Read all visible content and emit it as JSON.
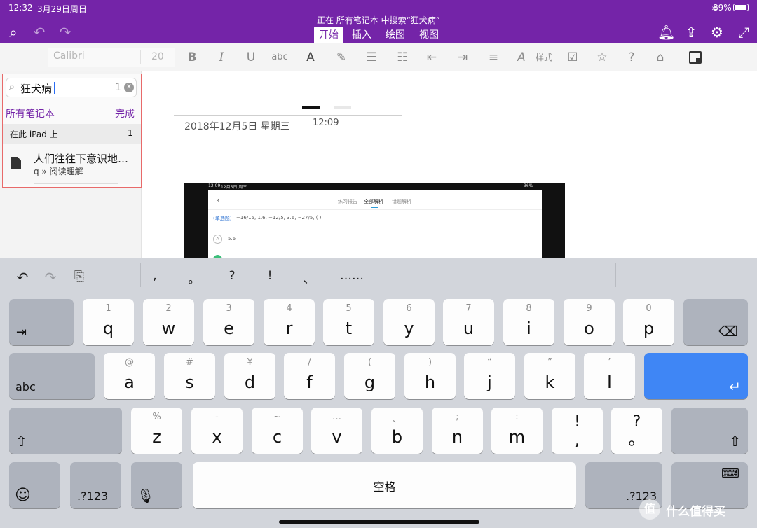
{
  "status_bar": {
    "time": "12:32",
    "date": "3月29日周日",
    "battery": "89%"
  },
  "title_bar": {
    "search_status": "正在 所有笔记本 中搜索“狂犬病”",
    "tabs": [
      "开始",
      "插入",
      "绘图",
      "视图"
    ],
    "active_tab": "开始"
  },
  "ribbon": {
    "font_name": "Calibri",
    "font_size": "20",
    "style_label": "样式"
  },
  "search": {
    "query": "狂犬病",
    "count": "1",
    "scope_label": "所有笔记本",
    "done_label": "完成",
    "location_label": "在此 iPad 上",
    "location_count": "1",
    "results": [
      {
        "title": "人们往往下意识地…",
        "path": "q » 阅读理解"
      }
    ]
  },
  "page": {
    "date": "2018年12月5日 星期三",
    "time": "12:09",
    "embed": {
      "status_time": "12:09",
      "status_date": "12月5日 周三",
      "status_battery": "36%",
      "tabs": [
        "练习报告",
        "全部解析",
        "错题解析"
      ],
      "question_label": "(单选题)",
      "option_letter": "A",
      "option_value": "5.6"
    }
  },
  "keyboard": {
    "prediction_symbols": [
      ",",
      "。",
      "?",
      "!",
      "、",
      "……"
    ],
    "row1": [
      {
        "sub": "1",
        "main": "q"
      },
      {
        "sub": "2",
        "main": "w"
      },
      {
        "sub": "3",
        "main": "e"
      },
      {
        "sub": "4",
        "main": "r"
      },
      {
        "sub": "5",
        "main": "t"
      },
      {
        "sub": "6",
        "main": "y"
      },
      {
        "sub": "7",
        "main": "u"
      },
      {
        "sub": "8",
        "main": "i"
      },
      {
        "sub": "9",
        "main": "o"
      },
      {
        "sub": "0",
        "main": "p"
      }
    ],
    "row2": [
      {
        "sub": "@",
        "main": "a"
      },
      {
        "sub": "#",
        "main": "s"
      },
      {
        "sub": "¥",
        "main": "d"
      },
      {
        "sub": "/",
        "main": "f"
      },
      {
        "sub": "(",
        "main": "g"
      },
      {
        "sub": ")",
        "main": "h"
      },
      {
        "sub": "“",
        "main": "j"
      },
      {
        "sub": "”",
        "main": "k"
      },
      {
        "sub": "’",
        "main": "l"
      }
    ],
    "row3": [
      {
        "sub": "%",
        "main": "z"
      },
      {
        "sub": "-",
        "main": "x"
      },
      {
        "sub": "~",
        "main": "c"
      },
      {
        "sub": "…",
        "main": "v"
      },
      {
        "sub": "、",
        "main": "b"
      },
      {
        "sub": ";",
        "main": "n"
      },
      {
        "sub": ":",
        "main": "m"
      },
      {
        "sub": "!",
        "main": ","
      },
      {
        "sub": "?",
        "main": "。"
      }
    ],
    "abc_label": "abc",
    "numbers_label": ".?123",
    "space_label": "空格"
  },
  "watermark": {
    "text": "什么值得买"
  }
}
